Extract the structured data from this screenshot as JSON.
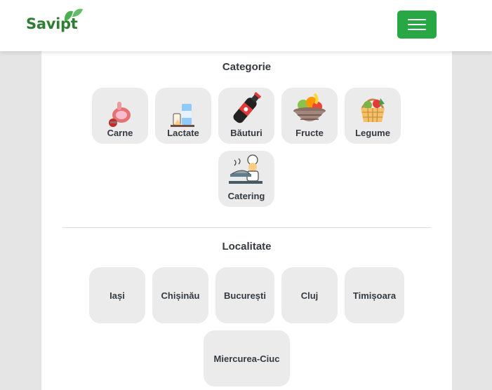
{
  "header": {
    "logo_text": "Savipt",
    "menu_icon": "hamburger-icon",
    "brand_color": "#2e7d32",
    "toggle_color": "#28a745"
  },
  "categories": {
    "title": "Categorie",
    "items": [
      {
        "label": "Carne",
        "icon": "meat-icon"
      },
      {
        "label": "Lactate",
        "icon": "dairy-icon"
      },
      {
        "label": "Băuturi",
        "icon": "soda-bottle-icon"
      },
      {
        "label": "Fructe",
        "icon": "fruit-basket-icon"
      },
      {
        "label": "Legume",
        "icon": "vegetable-basket-icon"
      },
      {
        "label": "Catering",
        "icon": "chef-icon"
      }
    ]
  },
  "localities": {
    "title": "Localitate",
    "items": [
      {
        "label": "Iași"
      },
      {
        "label": "Chișinău"
      },
      {
        "label": "București"
      },
      {
        "label": "Cluj"
      },
      {
        "label": "Timișoara"
      },
      {
        "label": "Miercurea-Ciuc"
      }
    ]
  }
}
